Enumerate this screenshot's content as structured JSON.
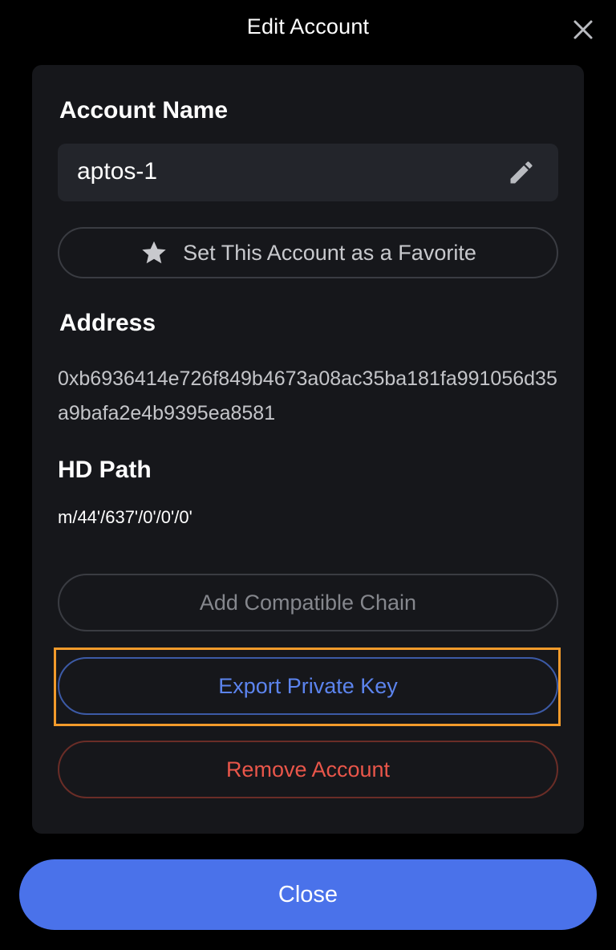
{
  "header": {
    "title": "Edit Account"
  },
  "account_name": {
    "label": "Account Name",
    "value": "aptos-1"
  },
  "favorite": {
    "label": "Set This Account as a Favorite"
  },
  "address": {
    "label": "Address",
    "value": "0xb6936414e726f849b4673a08ac35ba181fa991056d35a9bafa2e4b9395ea8581"
  },
  "hd_path": {
    "label": "HD Path",
    "value": "m/44'/637'/0'/0'/0'"
  },
  "actions": {
    "add_chain": "Add Compatible Chain",
    "export_key": "Export Private Key",
    "remove_account": "Remove Account"
  },
  "footer": {
    "close": "Close"
  },
  "colors": {
    "accent": "#4a72ea",
    "export_text": "#5c84ee",
    "danger": "#e9564a",
    "highlight": "#f39b2b"
  },
  "icons": {
    "close": "close-icon",
    "edit": "pencil-icon",
    "favorite": "star-icon"
  }
}
